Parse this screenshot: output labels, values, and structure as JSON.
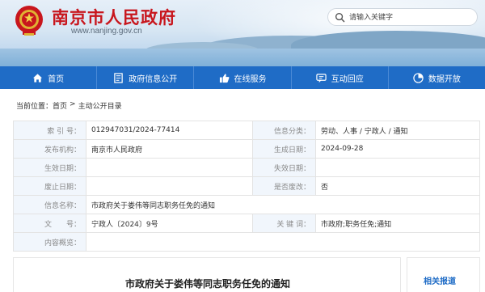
{
  "header": {
    "site_title": "南京市人民政府",
    "site_url": "www.nanjing.gov.cn",
    "search_placeholder": "请输入关键字"
  },
  "nav": {
    "items": [
      {
        "label": "首页",
        "icon": "home-icon"
      },
      {
        "label": "政府信息公开",
        "icon": "document-icon"
      },
      {
        "label": "在线服务",
        "icon": "thumbs-up-icon"
      },
      {
        "label": "互动回应",
        "icon": "chat-icon"
      },
      {
        "label": "数据开放",
        "icon": "chart-icon"
      }
    ]
  },
  "breadcrumb": {
    "prefix": "当前位置：",
    "home": "首页",
    "separator": ">",
    "current": "主动公开目录"
  },
  "info": {
    "index_no_label": "索 引 号：",
    "index_no": "012947031/2024-77414",
    "category_label": "信息分类：",
    "category": "劳动、人事 / 宁政人 / 通知",
    "publisher_label": "发布机构：",
    "publisher": "南京市人民政府",
    "created_label": "生成日期：",
    "created": "2024-09-28",
    "effective_label": "生效日期：",
    "effective": "",
    "expiry_label": "失效日期：",
    "expiry": "",
    "repeal_label": "废止日期：",
    "repeal": "",
    "abolished_label": "是否废改：",
    "abolished": "否",
    "name_label": "信息名称：",
    "name": "市政府关于娄伟等同志职务任免的通知",
    "docno_label": "文　　号：",
    "docno": "宁政人〔2024〕9号",
    "keywords_label": "关 键 词：",
    "keywords": "市政府;职务任免;通知",
    "summary_label": "内容概览：",
    "summary": ""
  },
  "document": {
    "title": "市政府关于娄伟等同志职务任免的通知"
  },
  "related": {
    "title": "相关报道"
  },
  "colors": {
    "brand_red": "#c8161d",
    "nav_blue": "#1f6cc6",
    "label_bg": "#f1f6fc"
  }
}
